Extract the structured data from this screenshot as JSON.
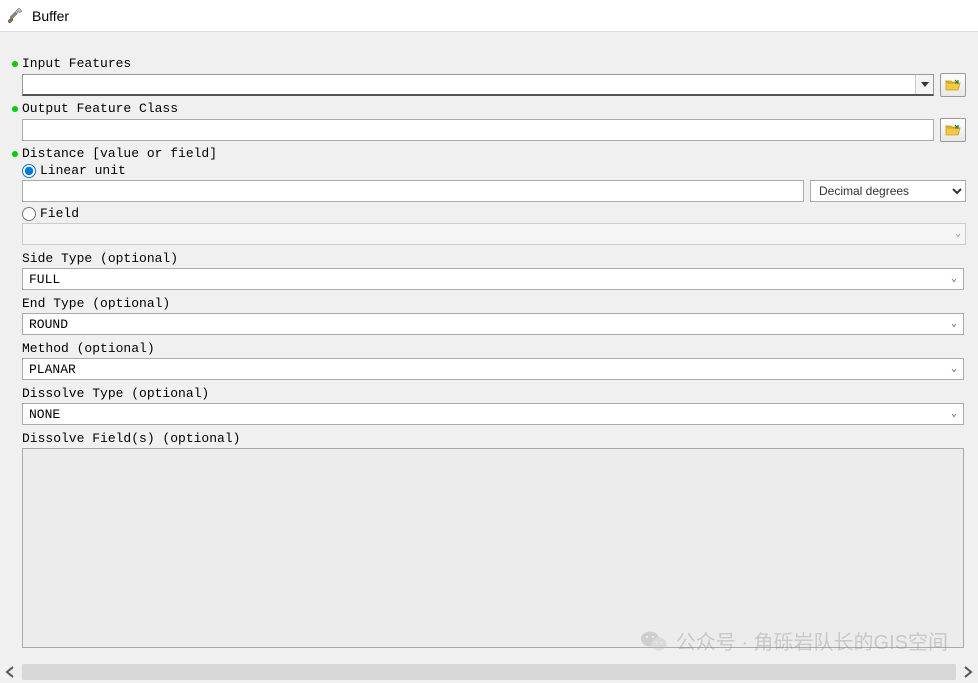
{
  "window": {
    "title": "Buffer"
  },
  "params": {
    "input_features": {
      "label": "Input Features",
      "value": ""
    },
    "output_feature_class": {
      "label": "Output Feature Class",
      "value": ""
    },
    "distance": {
      "label": "Distance [value or field]",
      "linear_unit_label": "Linear unit",
      "linear_value": "",
      "unit_selected": "Decimal degrees",
      "field_label": "Field",
      "field_value": ""
    },
    "side_type": {
      "label": "Side Type (optional)",
      "value": "FULL"
    },
    "end_type": {
      "label": "End Type (optional)",
      "value": "ROUND"
    },
    "method": {
      "label": "Method (optional)",
      "value": "PLANAR"
    },
    "dissolve_type": {
      "label": "Dissolve Type (optional)",
      "value": "NONE"
    },
    "dissolve_fields": {
      "label": "Dissolve Field(s) (optional)"
    }
  },
  "watermark": {
    "text": "公众号 · 角砾岩队长的GIS空间"
  }
}
